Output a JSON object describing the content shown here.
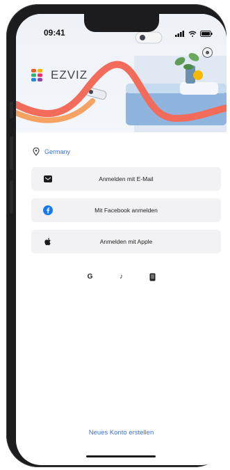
{
  "status_bar": {
    "time": "09:41"
  },
  "brand": {
    "name": "EZVIZ"
  },
  "location": {
    "country": "Germany"
  },
  "login_buttons": [
    {
      "label": "Anmelden mit E-Mail",
      "icon": "email-icon"
    },
    {
      "label": "Mit Facebook anmelden",
      "icon": "facebook-icon"
    },
    {
      "label": "Anmelden mit Apple",
      "icon": "apple-icon"
    }
  ],
  "social_icons": [
    "google-icon",
    "tiktok-icon",
    "phone-icon"
  ],
  "social_glyphs": {
    "google": "G",
    "tiktok": "♪"
  },
  "create_account": {
    "label": "Neues Konto erstellen"
  },
  "colors": {
    "link": "#3a72d8",
    "button_bg": "#f2f2f4",
    "facebook": "#1877f2"
  }
}
